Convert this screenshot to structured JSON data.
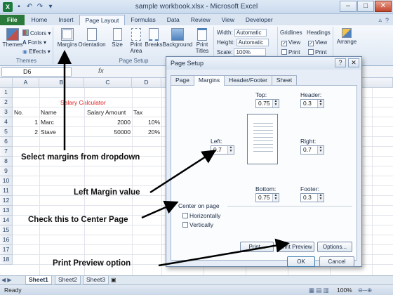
{
  "window": {
    "title": "sample workbook.xlsx - Microsoft Excel",
    "minimize": "–",
    "maximize": "□",
    "close": "✕"
  },
  "ribbon": {
    "tabs": [
      "File",
      "Home",
      "Insert",
      "Page Layout",
      "Formulas",
      "Data",
      "Review",
      "View",
      "Developer"
    ],
    "active_tab": "Page Layout",
    "themes_group": {
      "label": "Themes",
      "themes_button": "Themes",
      "colors": "Colors",
      "fonts": "Fonts",
      "effects": "Effects"
    },
    "page_setup_group": {
      "label": "Page Setup",
      "margins": "Margins",
      "orientation": "Orientation",
      "size": "Size",
      "print_area": "Print Area",
      "breaks": "Breaks",
      "background": "Background",
      "print_titles": "Print Titles"
    },
    "scale_group": {
      "width_label": "Width:",
      "width_value": "Automatic",
      "height_label": "Height:",
      "height_value": "Automatic",
      "scale_label": "Scale:",
      "scale_value": "100%"
    },
    "sheet_options": {
      "gridlines": "Gridlines",
      "headings": "Headings",
      "view": "View",
      "print": "Print"
    },
    "arrange": "Arrange"
  },
  "formula_bar": {
    "name_box": "D6",
    "fx": "fx"
  },
  "grid": {
    "columns": [
      "A",
      "B",
      "C",
      "D"
    ],
    "rows": [
      "1",
      "2",
      "3",
      "4",
      "5",
      "6",
      "7",
      "8",
      "9",
      "10",
      "11",
      "12",
      "13",
      "14",
      "15",
      "16",
      "17",
      "18"
    ],
    "title_cell": "Salary Calculator",
    "headers": [
      "No.",
      "Name",
      "Salary Amount",
      "Tax"
    ],
    "data": [
      {
        "no": "1",
        "name": "Marc",
        "salary": "2000",
        "tax": "10%"
      },
      {
        "no": "2",
        "name": "Stave",
        "salary": "50000",
        "tax": "20%"
      }
    ]
  },
  "annotations": {
    "margins": "Select margins from dropdown",
    "left_margin": "Left Margin value",
    "center_page": "Check this to Center Page",
    "print_preview": "Print Preview option"
  },
  "dialog": {
    "title": "Page Setup",
    "help": "?",
    "close": "✕",
    "tabs": [
      "Page",
      "Margins",
      "Header/Footer",
      "Sheet"
    ],
    "active_tab": "Margins",
    "top_label": "Top:",
    "top_value": "0.75",
    "header_label": "Header:",
    "header_value": "0.3",
    "left_label": "Left:",
    "left_value": "0.7",
    "right_label": "Right:",
    "right_value": "0.7",
    "bottom_label": "Bottom:",
    "bottom_value": "0.75",
    "footer_label": "Footer:",
    "footer_value": "0.3",
    "center_on_page": "Center on page",
    "horizontally": "Horizontally",
    "vertically": "Vertically",
    "print_button": "Print...",
    "print_preview_button": "Print Preview",
    "options_button": "Options...",
    "ok_button": "OK",
    "cancel_button": "Cancel"
  },
  "sheets": [
    "Sheet1",
    "Sheet2",
    "Sheet3"
  ],
  "active_sheet": "Sheet1",
  "status": {
    "ready": "Ready",
    "zoom": "100%"
  }
}
